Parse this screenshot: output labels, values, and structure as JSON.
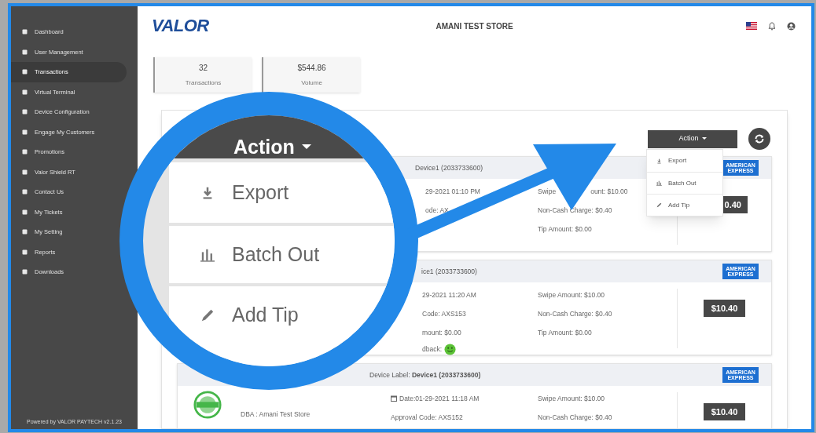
{
  "sidebar": {
    "items": [
      {
        "label": "Dashboard",
        "selected": false
      },
      {
        "label": "User Management",
        "selected": false
      },
      {
        "label": "Transactions",
        "selected": true
      },
      {
        "label": "Virtual Terminal",
        "selected": false
      },
      {
        "label": "Device Configuration",
        "selected": false
      },
      {
        "label": "Engage My Customers",
        "selected": false
      },
      {
        "label": "Promotions",
        "selected": false
      },
      {
        "label": "Valor Shield RT",
        "selected": false
      },
      {
        "label": "Contact Us",
        "selected": false
      },
      {
        "label": "My Tickets",
        "selected": false
      },
      {
        "label": "My Setting",
        "selected": false
      },
      {
        "label": "Reports",
        "selected": false
      },
      {
        "label": "Downloads",
        "selected": false
      }
    ],
    "footer": "Powered by VALOR PAYTECH v2.1.23"
  },
  "header": {
    "logo": "VALOR",
    "store_name": "AMANI TEST STORE"
  },
  "stats": [
    {
      "value": "32",
      "label": "Transactions"
    },
    {
      "value": "$544.86",
      "label": "Volume"
    }
  ],
  "action_button": {
    "label": "Action"
  },
  "action_menu": {
    "items": [
      "Export",
      "Batch Out",
      "Add Tip"
    ]
  },
  "magnifier": {
    "button_label": "Action",
    "items": [
      "Export",
      "Batch Out",
      "Add Tip"
    ]
  },
  "transactions": [
    {
      "header": "Device1 (2033733600)",
      "card_logo": "AMERICAN EXPRESS",
      "stamp": false,
      "column_b": [
        {
          "kind": "text",
          "text": "29-2021 01:10 PM"
        },
        {
          "kind": "text",
          "text": "ode: AX"
        }
      ],
      "column_c": [
        [
          "Swipe",
          "ount: $10.00"
        ],
        [
          "Non-Cash Charge: $0.40"
        ],
        [
          "Tip Amount: $0.00"
        ]
      ],
      "total": "0.40"
    },
    {
      "header": "ice1 (2033733600)",
      "card_logo": "AMERICAN EXPRESS",
      "stamp": false,
      "column_b": [
        {
          "kind": "text",
          "text": "29-2021 11:20 AM"
        },
        {
          "kind": "text",
          "text": "Code: AXS153"
        },
        {
          "kind": "text",
          "text": "mount: $0.00"
        },
        {
          "kind": "feedback",
          "text": "dback:"
        }
      ],
      "column_c": [
        [
          "Swipe Amount: $10.00"
        ],
        [
          "Non-Cash Charge: $0.40"
        ],
        [
          "Tip Amount: $0.00"
        ]
      ],
      "total": "$10.40"
    },
    {
      "header": "Device Label: **Device1 (2033733600)**",
      "card_logo": "AMERICAN EXPRESS",
      "stamp": true,
      "column_a": [
        "DBA : Amani Test Store"
      ],
      "column_b": [
        {
          "kind": "date",
          "text": "Date:01-29-2021 11:18 AM"
        },
        {
          "kind": "text",
          "text": "Approval Code: AXS152"
        }
      ],
      "column_c": [
        [
          "Swipe Amount: $10.00"
        ],
        [
          "Non-Cash Charge: $0.40"
        ]
      ],
      "total": "$10.40"
    }
  ]
}
